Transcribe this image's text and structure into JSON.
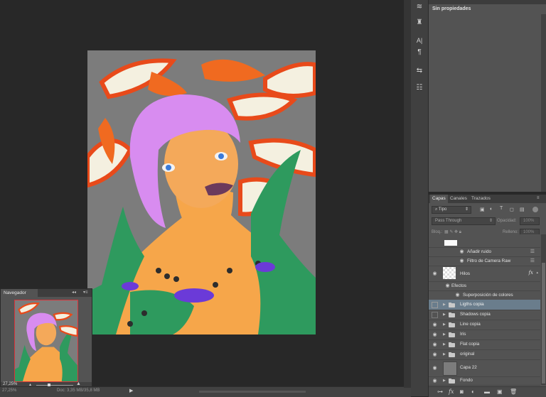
{
  "navigator": {
    "title": "Navegador",
    "zoom": "27,25%"
  },
  "statusbar": {
    "zoom": "27,25%",
    "doc": "Doc: 3,35 MB/35,8 MB"
  },
  "properties": {
    "title": "Sin propiedades"
  },
  "layers": {
    "tabs": [
      "Capas",
      "Canales",
      "Trazados"
    ],
    "filter": "Tipo",
    "blend_mode": "Pass Through",
    "opacity_label": "Opacidad:",
    "opacity_value": "100%",
    "lock_label": "Bloq.:",
    "fill_label": "Relleno:",
    "fill_value": "100%",
    "rows": [
      {
        "name": "Añadir ruido"
      },
      {
        "name": "Filtro de Camera Raw"
      },
      {
        "name": "Hilos"
      },
      {
        "name": "Efectos"
      },
      {
        "name": "Superposición de colores"
      },
      {
        "name": "Ligths copia"
      },
      {
        "name": "Shadows copia"
      },
      {
        "name": "Line copia"
      },
      {
        "name": "Iris"
      },
      {
        "name": "Flat  copia"
      },
      {
        "name": "original"
      },
      {
        "name": "Capa 22"
      },
      {
        "name": "Fondo"
      }
    ]
  },
  "icons": {
    "eye": "eye-icon",
    "folder": "folder-icon",
    "fx": "fx-icon",
    "lock": "lock-icon"
  },
  "colors": {
    "selected_row": "#6a7d8c",
    "hair": "#d88cf0",
    "skin": "#f6a64a",
    "tentacle": "#2e9a5e",
    "canvas_bg": "#7c7c7c"
  }
}
